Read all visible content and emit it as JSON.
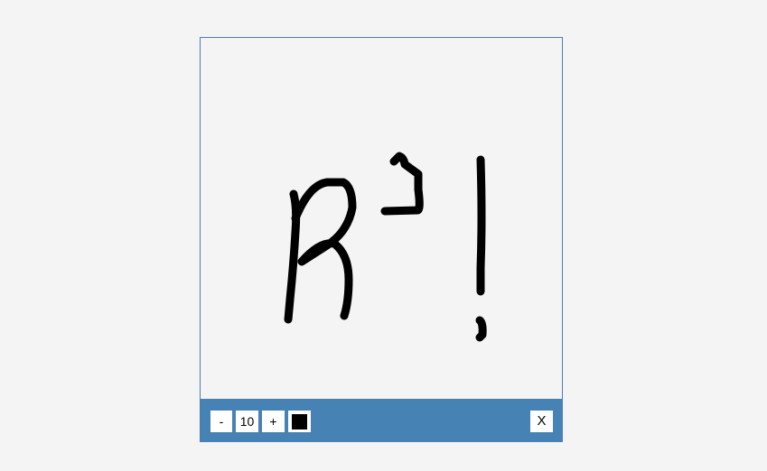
{
  "toolbar": {
    "decrease_label": "-",
    "brush_size": "10",
    "increase_label": "+",
    "brush_color": "#000000",
    "close_label": "X"
  },
  "colors": {
    "toolbar_background": "#4682b4",
    "panel_border": "#4a7fb5",
    "canvas_background": "#f4f4f4",
    "stroke_color": "#000000"
  }
}
